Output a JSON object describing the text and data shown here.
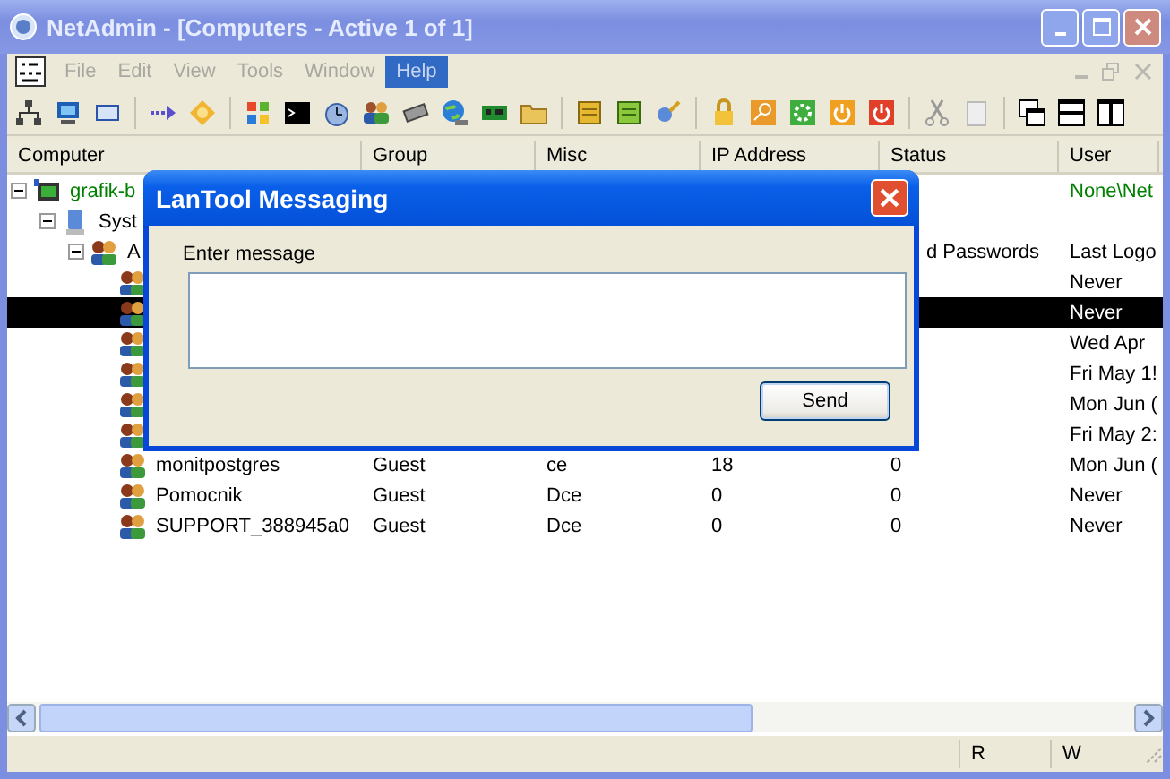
{
  "window": {
    "title": "NetAdmin - [Computers - Active 1 of 1]"
  },
  "menu": [
    {
      "label": "File",
      "selected": false
    },
    {
      "label": "Edit",
      "selected": false
    },
    {
      "label": "View",
      "selected": false
    },
    {
      "label": "Tools",
      "selected": false
    },
    {
      "label": "Window",
      "selected": false
    },
    {
      "label": "Help",
      "selected": true
    }
  ],
  "table": {
    "columns": [
      "Computer",
      "Group",
      "Misc",
      "IP Address",
      "Status",
      "User"
    ],
    "tree": [
      {
        "kind": "computer",
        "name": "grafik-b",
        "expanded": true,
        "selected": false,
        "user": "None\\Net",
        "children": [
          {
            "kind": "system",
            "name": "Syst",
            "expanded": true,
            "selected": false,
            "children": [
              {
                "kind": "group",
                "name": "A",
                "expanded": true,
                "selected": false,
                "status": "d Passwords",
                "user": "Last Logo",
                "children": [
                  {
                    "kind": "user",
                    "selected": false,
                    "user": "Never"
                  },
                  {
                    "kind": "user",
                    "selected": true,
                    "user": "Never"
                  },
                  {
                    "kind": "user",
                    "selected": false,
                    "user": "Wed Apr"
                  },
                  {
                    "kind": "user",
                    "selected": false,
                    "user": "Fri May 1!"
                  },
                  {
                    "kind": "user",
                    "selected": false,
                    "user": "Mon Jun ("
                  },
                  {
                    "kind": "user",
                    "selected": false,
                    "user": "Fri May 2:"
                  },
                  {
                    "kind": "user",
                    "selected": false,
                    "name": "monitpostgres",
                    "group": "Guest",
                    "misc": "ce",
                    "ip": "18",
                    "status": "0",
                    "user": "Mon Jun ("
                  },
                  {
                    "kind": "user",
                    "selected": false,
                    "name": "Pomocnik",
                    "group": "Guest",
                    "misc": "Dce",
                    "ip": "0",
                    "status": "0",
                    "user": "Never"
                  },
                  {
                    "kind": "user",
                    "selected": false,
                    "name": "SUPPORT_388945a0",
                    "group": "Guest",
                    "misc": "Dce",
                    "ip": "0",
                    "status": "0",
                    "user": "Never"
                  }
                ]
              }
            ]
          }
        ]
      }
    ]
  },
  "dialog": {
    "title": "LanTool Messaging",
    "label": "Enter message",
    "button": "Send"
  },
  "status_bar": {
    "panels": [
      "R",
      "W"
    ]
  }
}
